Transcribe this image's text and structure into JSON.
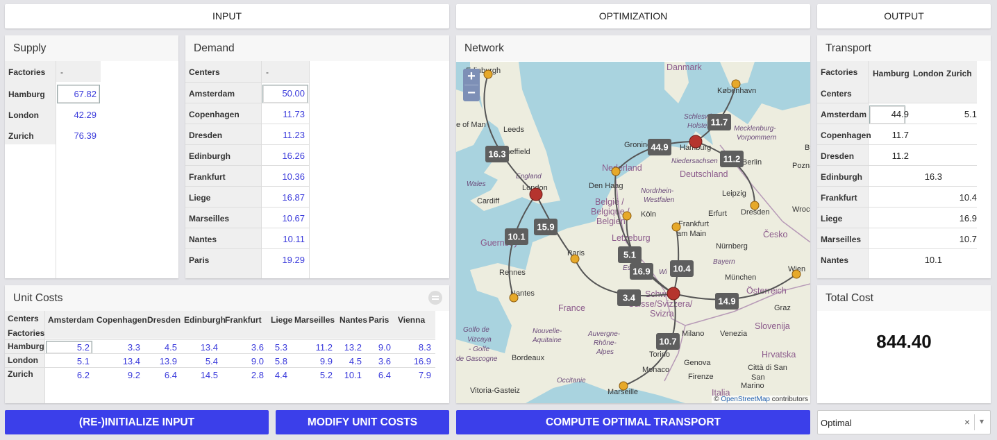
{
  "headers": {
    "input": "INPUT",
    "optimization": "OPTIMIZATION",
    "output": "OUTPUT"
  },
  "supply": {
    "title": "Supply",
    "col_label": "Factories",
    "col_value_header": "-",
    "rows": [
      {
        "name": "Hamburg",
        "value": "67.82"
      },
      {
        "name": "London",
        "value": "42.29"
      },
      {
        "name": "Zurich",
        "value": "76.39"
      }
    ]
  },
  "demand": {
    "title": "Demand",
    "col_label": "Centers",
    "col_value_header": "-",
    "rows": [
      {
        "name": "Amsterdam",
        "value": "50.00"
      },
      {
        "name": "Copenhagen",
        "value": "11.73"
      },
      {
        "name": "Dresden",
        "value": "11.23"
      },
      {
        "name": "Edinburgh",
        "value": "16.26"
      },
      {
        "name": "Frankfurt",
        "value": "10.36"
      },
      {
        "name": "Liege",
        "value": "16.87"
      },
      {
        "name": "Marseilles",
        "value": "10.67"
      },
      {
        "name": "Nantes",
        "value": "10.11"
      },
      {
        "name": "Paris",
        "value": "19.29"
      }
    ]
  },
  "unit_costs": {
    "title": "Unit Costs",
    "corner_top": "Centers",
    "corner_bottom": "Factories",
    "columns": [
      "Amsterdam",
      "Copenhagen",
      "Dresden",
      "Edinburgh",
      "Frankfurt",
      "Liege",
      "Marseilles",
      "Nantes",
      "Paris",
      "Vienna"
    ],
    "rows": [
      {
        "name": "Hamburg",
        "values": [
          "5.2",
          "3.3",
          "4.5",
          "13.4",
          "3.6",
          "5.3",
          "11.2",
          "13.2",
          "9.0",
          "8.3"
        ]
      },
      {
        "name": "London",
        "values": [
          "5.1",
          "13.4",
          "13.9",
          "5.4",
          "9.0",
          "5.8",
          "9.9",
          "4.5",
          "3.6",
          "16.9"
        ]
      },
      {
        "name": "Zurich",
        "values": [
          "6.2",
          "9.2",
          "6.4",
          "14.5",
          "2.8",
          "4.4",
          "5.2",
          "10.1",
          "6.4",
          "7.9"
        ]
      }
    ]
  },
  "network": {
    "title": "Network",
    "zoom_in": "+",
    "zoom_out": "−",
    "attribution_prefix": "©",
    "attribution_link": "OpenStreetMap",
    "attribution_suffix": "contributors",
    "edge_labels": [
      "11.7",
      "44.9",
      "11.2",
      "16.3",
      "15.9",
      "10.1",
      "5.1",
      "16.9",
      "10.4",
      "3.4",
      "14.9",
      "10.7"
    ],
    "map_labels": [
      "Danmark",
      "København",
      "Edinburgh",
      "Leeds",
      "Sheffield",
      "England",
      "Wales",
      "London",
      "Cardiff",
      "Guernsey",
      "Rennes",
      "Nantes",
      "Paris",
      "France",
      "Golfo de",
      "Vizcaya",
      "- Golfe",
      "de Gascogne",
      "Bordeaux",
      "Nouvelle-",
      "Aquitaine",
      "Occitanie",
      "Vitoria-Gasteiz",
      "Marseille",
      "Auvergne-",
      "Rhône-",
      "Alpes",
      "Monaco",
      "Torino",
      "Milano",
      "Genova",
      "Firenze",
      "Italia",
      "San",
      "Marino",
      "Città di San",
      "Venezia",
      "Slovenija",
      "Hrvatska",
      "Graz",
      "Wien",
      "Österreich",
      "München",
      "Nürnberg",
      "Bayern",
      "Česko",
      "Dresden",
      "Leipzig",
      "Erfurt",
      "Berlin",
      "Hamburg",
      "Deutschland",
      "Niedersachsen",
      "Schleswig-",
      "Holstein",
      "Mecklenburg-",
      "Vorpommern",
      "Groningen",
      "Nederland",
      "Den Haag",
      "België /",
      "Belgique /",
      "Belgien",
      "Köln",
      "Nordrhein-",
      "Westfalen",
      "Frankfurt",
      "am Main",
      "Letzeburg",
      "Schweiz/",
      "Suisse/Svizzera/",
      "Svizra",
      "Poznań",
      "Wrocław",
      "e of Man",
      "By",
      "Es",
      "Wi"
    ]
  },
  "transport": {
    "title": "Transport",
    "corner_top": "Factories",
    "corner_bottom": "Centers",
    "columns": [
      "Hamburg",
      "London",
      "Zurich"
    ],
    "rows": [
      {
        "name": "Amsterdam",
        "values": [
          "44.9",
          "",
          "5.1"
        ]
      },
      {
        "name": "Copenhagen",
        "values": [
          "11.7",
          "",
          ""
        ]
      },
      {
        "name": "Dresden",
        "values": [
          "11.2",
          "",
          ""
        ]
      },
      {
        "name": "Edinburgh",
        "values": [
          "",
          "16.3",
          ""
        ]
      },
      {
        "name": "Frankfurt",
        "values": [
          "",
          "",
          "10.4"
        ]
      },
      {
        "name": "Liege",
        "values": [
          "",
          "",
          "16.9"
        ]
      },
      {
        "name": "Marseilles",
        "values": [
          "",
          "",
          "10.7"
        ]
      },
      {
        "name": "Nantes",
        "values": [
          "",
          "10.1",
          ""
        ]
      }
    ]
  },
  "total_cost": {
    "title": "Total Cost",
    "value": "844.40"
  },
  "buttons": {
    "reinit": "(RE-)INITIALIZE INPUT",
    "modify": "MODIFY UNIT COSTS",
    "compute": "COMPUTE OPTIMAL TRANSPORT"
  },
  "status_select": {
    "value": "Optimal",
    "clear": "×",
    "arrow": "▾"
  },
  "colors": {
    "button": "#3b3fea",
    "value_text": "#3a3adb",
    "factory_node": "#b5342e",
    "center_node": "#e6a92a"
  }
}
